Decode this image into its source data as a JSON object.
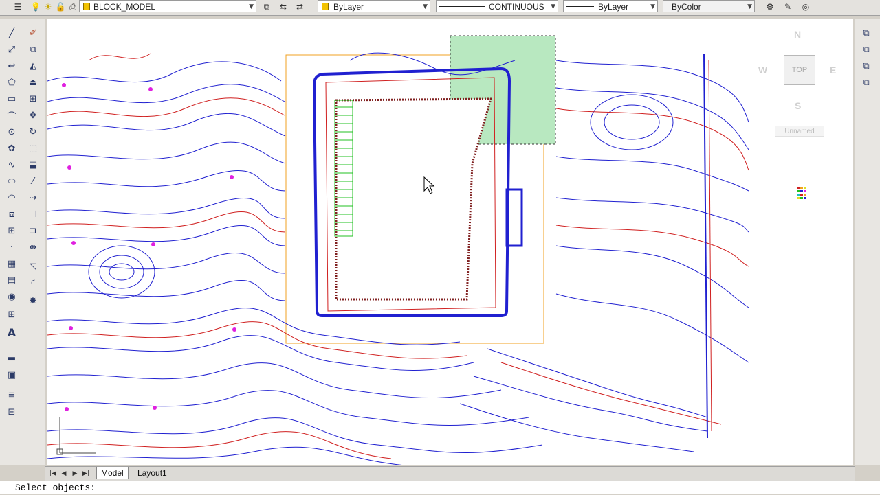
{
  "toolbar": {
    "layer_name": "BLOCK_MODEL",
    "color_value": "ByLayer",
    "linetype_value": "CONTINUOUS",
    "lineweight_value": "ByLayer",
    "plotstyle_value": "ByColor"
  },
  "viewcube": {
    "north": "N",
    "south": "S",
    "east": "E",
    "west": "W",
    "face": "TOP",
    "ucs_name": "Unnamed"
  },
  "tabs": {
    "model": "Model",
    "layout1": "Layout1"
  },
  "command_line": {
    "prompt": "Select objects:"
  },
  "colors": {
    "contour_major": "#d02020",
    "contour_minor": "#2020d0",
    "hatch": "#20c020",
    "selection_fill": "#b8e8c0",
    "boundary": "#f0a020"
  },
  "icons": {
    "left_toolbar": [
      "line-icon",
      "construction-line-icon",
      "polyline-icon",
      "polygon-icon",
      "rectangle-icon",
      "arc-icon",
      "circle-icon",
      "revision-cloud-icon",
      "spline-icon",
      "ellipse-icon",
      "ellipse-arc-icon",
      "insert-block-icon",
      "make-block-icon",
      "point-icon",
      "hatch-icon",
      "gradient-icon",
      "region-icon",
      "table-icon",
      "multiline-text-icon"
    ],
    "modify_toolbar": [
      "erase-icon",
      "copy-icon",
      "mirror-icon",
      "offset-icon",
      "array-icon",
      "move-icon",
      "rotate-icon",
      "scale-icon",
      "stretch-icon",
      "trim-icon",
      "extend-icon",
      "break-icon",
      "join-icon",
      "chamfer-icon",
      "fillet-icon",
      "explode-icon"
    ]
  }
}
